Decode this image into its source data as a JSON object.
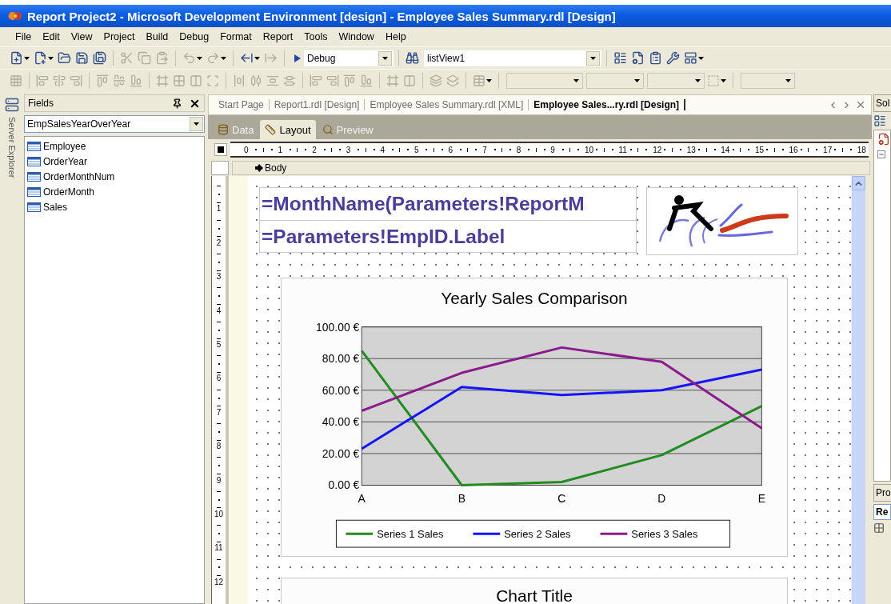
{
  "window": {
    "title": "Report Project2 - Microsoft Development Environment [design] - Employee Sales Summary.rdl [Design]"
  },
  "menu": [
    "File",
    "Edit",
    "View",
    "Project",
    "Build",
    "Debug",
    "Format",
    "Report",
    "Tools",
    "Window",
    "Help"
  ],
  "standard_toolbar": {
    "buttons": [
      {
        "disabled": false
      },
      {
        "disabled": false
      },
      {
        "disabled": false
      },
      {
        "disabled": false
      },
      {
        "disabled": false
      },
      {
        "disabled": true
      },
      {
        "disabled": true
      },
      {
        "disabled": true
      },
      {
        "disabled": true
      },
      {
        "disabled": true
      },
      {
        "disabled": false
      },
      {
        "disabled": true
      },
      {
        "disabled": false
      },
      {
        "disabled": false
      },
      {
        "disabled": false
      },
      {
        "disabled": false
      },
      {
        "disabled": false
      },
      {
        "disabled": false
      }
    ],
    "configuration": "Debug",
    "startup_object": "listView1"
  },
  "layout_toolbar": {
    "buttons": [
      {
        "disabled": true
      },
      {
        "disabled": true
      },
      {
        "disabled": true
      },
      {
        "disabled": true
      },
      {
        "disabled": true
      },
      {
        "disabled": true
      },
      {
        "disabled": true
      },
      {
        "disabled": true
      },
      {
        "disabled": true
      },
      {
        "disabled": true
      },
      {
        "disabled": true
      },
      {
        "disabled": true
      },
      {
        "disabled": true
      },
      {
        "disabled": true
      },
      {
        "disabled": true
      },
      {
        "disabled": true
      },
      {
        "disabled": true
      },
      {
        "disabled": true
      },
      {
        "disabled": true
      },
      {
        "disabled": true
      },
      {
        "disabled": true
      },
      {
        "disabled": true
      },
      {
        "disabled": true
      },
      {
        "disabled": true
      },
      {
        "disabled": true
      }
    ],
    "dropdowns": [
      {
        "disabled": true
      },
      {
        "disabled": true
      },
      {
        "disabled": true
      },
      {
        "disabled": true
      }
    ]
  },
  "server_explorer": {
    "label": "Server Explorer"
  },
  "fields_panel": {
    "title": "Fields",
    "dataset": "EmpSalesYearOverYear",
    "fields": [
      "Employee",
      "OrderYear",
      "OrderMonthNum",
      "OrderMonth",
      "Sales"
    ]
  },
  "document_tabs": [
    {
      "label": "Start Page",
      "selected": false
    },
    {
      "label": "Report1.rdl [Design]",
      "selected": false
    },
    {
      "label": "Employee Sales Summary.rdl [XML]",
      "selected": false
    },
    {
      "label": "Employee Sales...ry.rdl [Design]",
      "selected": true
    }
  ],
  "view_tabs": [
    {
      "label": "Data",
      "selected": false
    },
    {
      "label": "Layout",
      "selected": true
    },
    {
      "label": "Preview",
      "selected": false
    }
  ],
  "horizontal_ruler": [
    "0",
    "1",
    "2",
    "3",
    "4",
    "5",
    "6",
    "7",
    "8",
    "9",
    "10",
    "11",
    "12",
    "13",
    "14",
    "15",
    "16",
    "17",
    "18"
  ],
  "vertical_ruler": [
    "1",
    "2",
    "3",
    "4",
    "5",
    "6",
    "7",
    "8",
    "9",
    "10",
    "11",
    "12"
  ],
  "section": {
    "label": "Body"
  },
  "report": {
    "header_lines": [
      "=MonthName(Parameters!ReportM",
      "=Parameters!EmpID.Label"
    ],
    "chart": {
      "chart_data": {
        "type": "line",
        "title": "Yearly Sales Comparison",
        "categories": [
          "A",
          "B",
          "C",
          "D",
          "E"
        ],
        "series": [
          {
            "name": "Series 1 Sales",
            "color": "#228b22",
            "values": [
              85,
              0,
              2,
              19,
              50
            ]
          },
          {
            "name": "Series 2 Sales",
            "color": "#1414ff",
            "values": [
              23,
              62,
              57,
              60,
              73
            ]
          },
          {
            "name": "Series 3 Sales",
            "color": "#8b1a8b",
            "values": [
              47,
              71,
              87,
              78,
              36
            ]
          }
        ],
        "ylim": [
          0,
          100
        ],
        "grid": true,
        "legend": "bottom",
        "yticks": [
          {
            "value": 0,
            "label": "0.00 €"
          },
          {
            "value": 20,
            "label": "20.00 €"
          },
          {
            "value": 40,
            "label": "40.00 €"
          },
          {
            "value": 60,
            "label": "60.00 €"
          },
          {
            "value": 80,
            "label": "80.00 €"
          },
          {
            "value": 100,
            "label": "100.00 €"
          }
        ]
      }
    },
    "second_chart": {
      "title": "Chart Title"
    }
  },
  "right_panel": {
    "solution_tab": "Sol",
    "properties_tab": "Pro",
    "properties_object": "Re"
  }
}
